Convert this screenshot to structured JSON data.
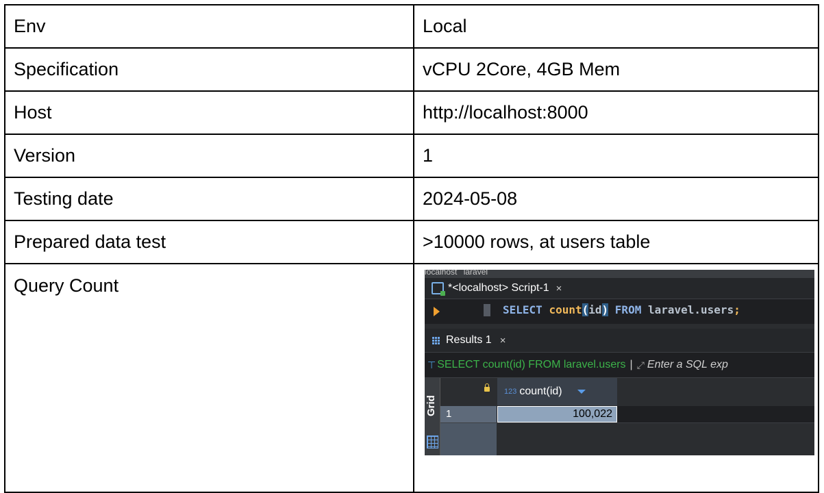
{
  "rows": [
    {
      "key": "Env",
      "value": "Local"
    },
    {
      "key": "Specification",
      "value": "vCPU 2Core, 4GB Mem"
    },
    {
      "key": "Host",
      "value": "http://localhost:8000"
    },
    {
      "key": "Version",
      "value": "1"
    },
    {
      "key": "Testing date",
      "value": "2024-05-08"
    },
    {
      "key": "Prepared data test",
      "value": ">10000 rows, at users table"
    }
  ],
  "query_count": {
    "key": "Query Count",
    "screenshot": {
      "toolbar": {
        "connection": "localhost",
        "database": "laravel"
      },
      "editor_tab": {
        "label": "*<localhost> Script-1",
        "close": "×"
      },
      "sql": {
        "select": "SELECT",
        "fn": "count",
        "open": "(",
        "arg": "id",
        "close": ")",
        "from": "FROM",
        "target": "laravel.users",
        "semi": ";"
      },
      "results_tab": {
        "label": "Results 1",
        "close": "×"
      },
      "filter": {
        "icon": "⊤",
        "sql": "SELECT count(id) FROM laravel.users",
        "placeholder": "Enter a SQL exp"
      },
      "grid": {
        "side_label": "Grid",
        "column_type": "123",
        "column_name": "count(id)",
        "row_number": "1",
        "value": "100,022"
      }
    }
  }
}
